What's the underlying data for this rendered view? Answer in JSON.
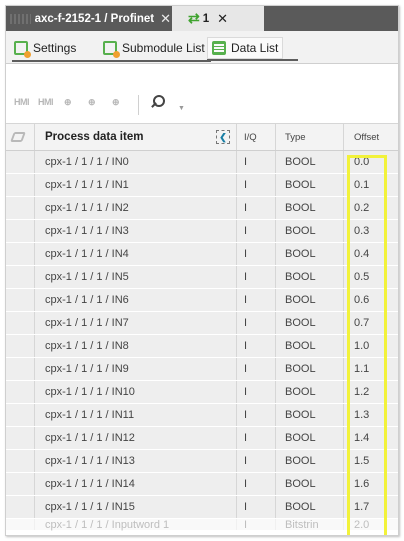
{
  "editor_tabs": [
    {
      "label": "axc-f-2152-1 / Profinet",
      "close": "✕"
    },
    {
      "label": "1",
      "close": "✕"
    }
  ],
  "view_tabs": [
    "Settings",
    "Submodule List",
    "Data List"
  ],
  "toolbar": {
    "icons": [
      "HMI",
      "HMI",
      "⊕",
      "⊕",
      "⊕"
    ]
  },
  "table": {
    "headers": {
      "name": "Process data item",
      "iq": "I/Q",
      "type": "Type",
      "offset": "Offset",
      "collapse": "❮"
    },
    "rows": [
      {
        "name": "cpx-1 / 1 / 1 / IN0",
        "iq": "I",
        "type": "BOOL",
        "offset": "0.0"
      },
      {
        "name": "cpx-1 / 1 / 1 / IN1",
        "iq": "I",
        "type": "BOOL",
        "offset": "0.1"
      },
      {
        "name": "cpx-1 / 1 / 1 / IN2",
        "iq": "I",
        "type": "BOOL",
        "offset": "0.2"
      },
      {
        "name": "cpx-1 / 1 / 1 / IN3",
        "iq": "I",
        "type": "BOOL",
        "offset": "0.3"
      },
      {
        "name": "cpx-1 / 1 / 1 / IN4",
        "iq": "I",
        "type": "BOOL",
        "offset": "0.4"
      },
      {
        "name": "cpx-1 / 1 / 1 / IN5",
        "iq": "I",
        "type": "BOOL",
        "offset": "0.5"
      },
      {
        "name": "cpx-1 / 1 / 1 / IN6",
        "iq": "I",
        "type": "BOOL",
        "offset": "0.6"
      },
      {
        "name": "cpx-1 / 1 / 1 / IN7",
        "iq": "I",
        "type": "BOOL",
        "offset": "0.7"
      },
      {
        "name": "cpx-1 / 1 / 1 / IN8",
        "iq": "I",
        "type": "BOOL",
        "offset": "1.0"
      },
      {
        "name": "cpx-1 / 1 / 1 / IN9",
        "iq": "I",
        "type": "BOOL",
        "offset": "1.1"
      },
      {
        "name": "cpx-1 / 1 / 1 / IN10",
        "iq": "I",
        "type": "BOOL",
        "offset": "1.2"
      },
      {
        "name": "cpx-1 / 1 / 1 / IN11",
        "iq": "I",
        "type": "BOOL",
        "offset": "1.3"
      },
      {
        "name": "cpx-1 / 1 / 1 / IN12",
        "iq": "I",
        "type": "BOOL",
        "offset": "1.4"
      },
      {
        "name": "cpx-1 / 1 / 1 / IN13",
        "iq": "I",
        "type": "BOOL",
        "offset": "1.5"
      },
      {
        "name": "cpx-1 / 1 / 1 / IN14",
        "iq": "I",
        "type": "BOOL",
        "offset": "1.6"
      },
      {
        "name": "cpx-1 / 1 / 1 / IN15",
        "iq": "I",
        "type": "BOOL",
        "offset": "1.7"
      },
      {
        "name": "cpx-1 / 1 / 1 / Inputword 1",
        "iq": "I",
        "type": "Bitstrin",
        "offset": "2.0"
      }
    ]
  },
  "colors": {
    "highlight": "#f2f23a",
    "tabbar": "#5a5a5a",
    "accent_green": "#57b04d"
  }
}
